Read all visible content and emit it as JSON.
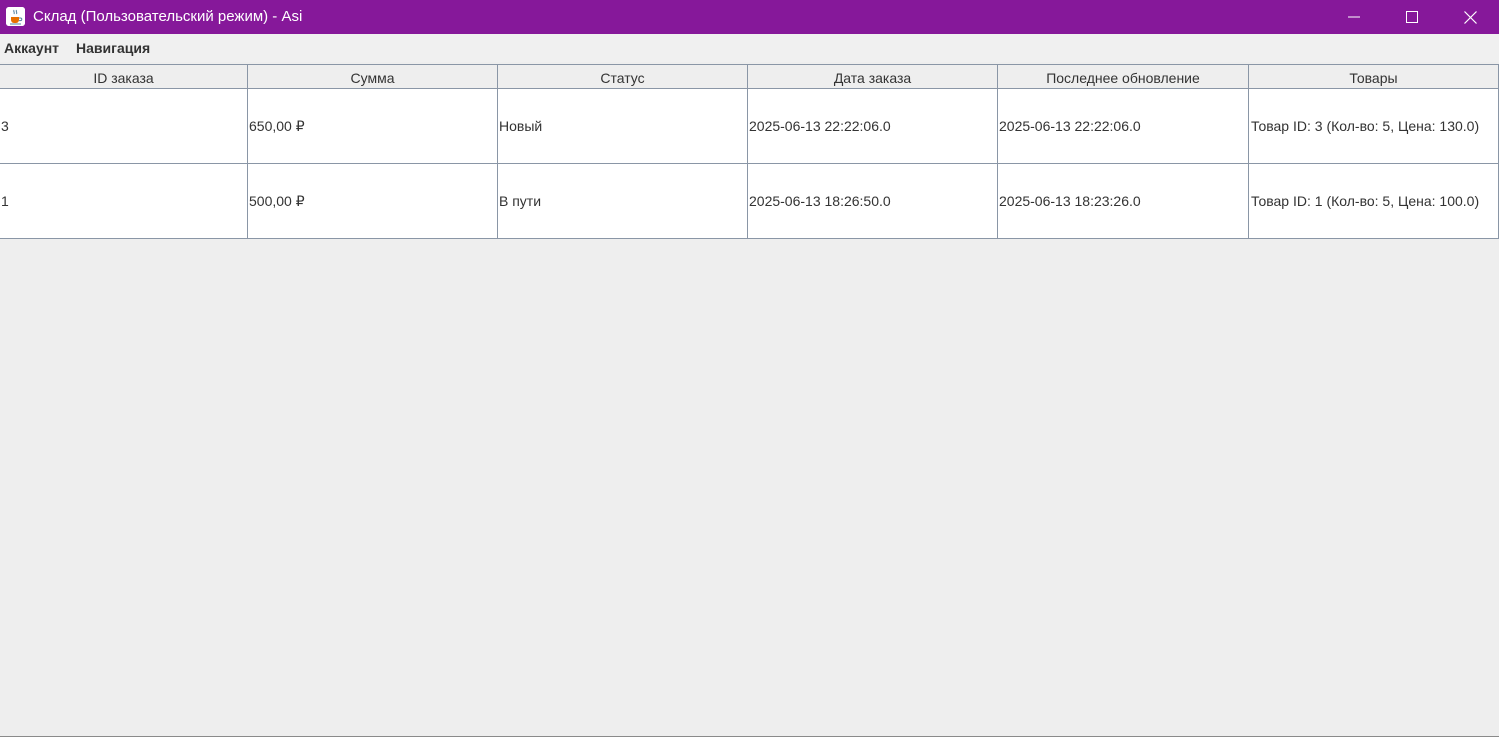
{
  "window": {
    "title": "Склад (Пользовательский режим) - Asi",
    "title_bar_color": "#86189a",
    "app_icon": "java-cup-icon",
    "controls": [
      "minimize-icon",
      "maximize-icon",
      "close-icon"
    ]
  },
  "menu": {
    "account": "Аккаунт",
    "navigation": "Навигация"
  },
  "table": {
    "columns": [
      "ID заказа",
      "Сумма",
      "Статус",
      "Дата заказа",
      "Последнее обновление",
      "Товары"
    ],
    "rows": [
      [
        "3",
        "650,00 ₽",
        "Новый",
        "2025-06-13 22:22:06.0",
        "2025-06-13 22:22:06.0",
        "Товар ID: 3 (Кол-во: 5, Цена: 130.0)"
      ],
      [
        "1",
        "500,00 ₽",
        "В пути",
        "2025-06-13 18:26:50.0",
        "2025-06-13 18:23:26.0",
        "Товар ID: 1 (Кол-во: 5, Цена: 100.0)"
      ]
    ]
  }
}
